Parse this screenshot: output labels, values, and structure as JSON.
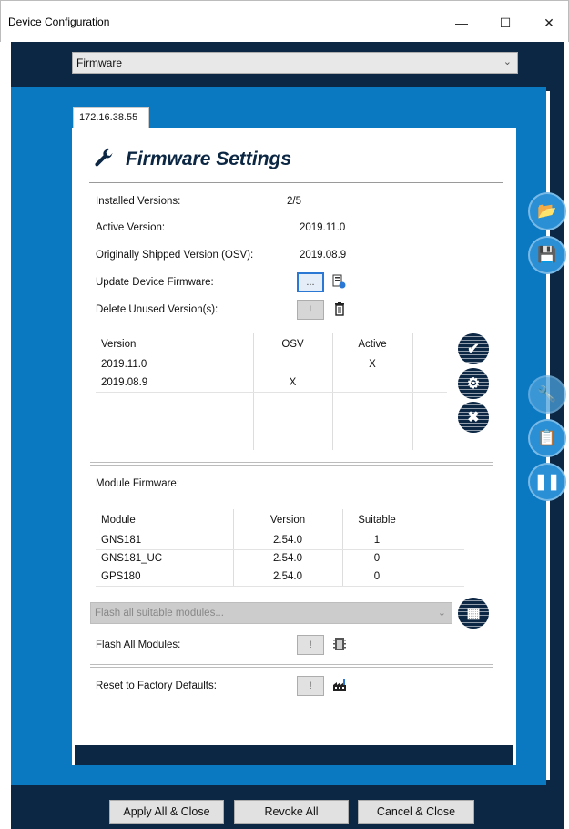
{
  "window": {
    "title": "Device Configuration",
    "minimize_glyph": "—",
    "maximize_glyph": "☐",
    "close_glyph": "✕"
  },
  "section_select": {
    "value": "Firmware"
  },
  "tab": {
    "label": "172.16.38.55"
  },
  "firmware": {
    "heading": "Firmware Settings",
    "installed_label": "Installed Versions:",
    "installed_value": "2/5",
    "active_label": "Active Version:",
    "active_value": "2019.11.0",
    "osv_label": "Originally Shipped Version (OSV):",
    "osv_value": "2019.08.9",
    "update_label": "Update Device Firmware:",
    "update_button": "...",
    "delete_label": "Delete Unused Version(s):",
    "delete_button": "!",
    "versions_table": {
      "headers": [
        "Version",
        "OSV",
        "Active"
      ],
      "rows": [
        [
          "2019.11.0",
          "",
          "X"
        ],
        [
          "2019.08.9",
          "X",
          ""
        ]
      ]
    }
  },
  "modules": {
    "label": "Module Firmware:",
    "headers": [
      "Module",
      "Version",
      "Suitable"
    ],
    "rows": [
      [
        "GNS181",
        "2.54.0",
        "1"
      ],
      [
        "GNS181_UC",
        "2.54.0",
        "0"
      ],
      [
        "GPS180",
        "2.54.0",
        "0"
      ]
    ],
    "flash_select_placeholder": "Flash all suitable modules...",
    "flash_all_label": "Flash All Modules:",
    "flash_all_button": "!",
    "reset_label": "Reset to Factory Defaults:",
    "reset_button": "!"
  },
  "footer": {
    "apply": "Apply All & Close",
    "revoke": "Revoke All",
    "cancel": "Cancel & Close"
  },
  "colors": {
    "dark_navy": "#0c2744",
    "blue": "#0b78c2",
    "side_button": "#2a8fd4"
  }
}
